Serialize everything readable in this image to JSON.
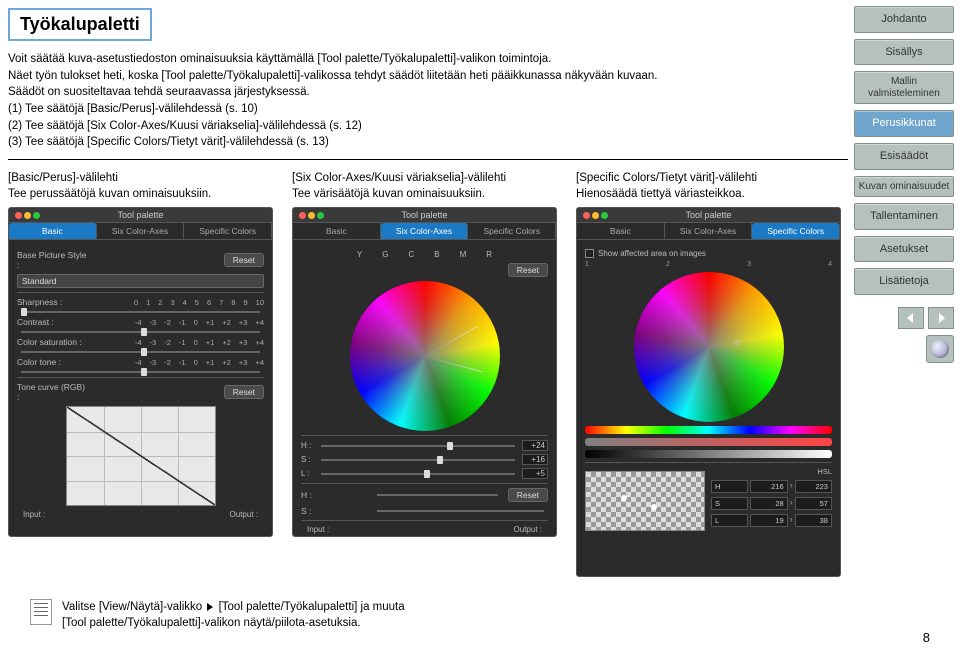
{
  "pageNumber": "8",
  "title": "Työkalupaletti",
  "intro": {
    "l1": "Voit säätää kuva-asetustiedoston ominaisuuksia käyttämällä [Tool palette/Työkalupaletti]-valikon toimintoja.",
    "l2": "Näet työn tulokset heti, koska [Tool palette/Työkalupaletti]-valikossa tehdyt säädöt liitetään heti pääikkunassa näkyvään kuvaan.",
    "l3": "Säädöt on suositeltavaa tehdä seuraavassa järjestyksessä.",
    "l4": "(1) Tee säätöjä [Basic/Perus]-välilehdessä (s. 10)",
    "l5": "(2) Tee säätöjä [Six Color-Axes/Kuusi väriakselia]-välilehdessä (s. 12)",
    "l6": "(3) Tee säätöjä [Specific Colors/Tietyt värit]-välilehdessä (s. 13)"
  },
  "cols": {
    "c1h": "[Basic/Perus]-välilehti",
    "c1s": "Tee perussäätöjä kuvan ominaisuuksiin.",
    "c2h": "[Six Color-Axes/Kuusi väriakselia]-välilehti",
    "c2s": "Tee värisäätöjä kuvan ominaisuuksiin.",
    "c3h": "[Specific Colors/Tietyt värit]-välilehti",
    "c3s": "Hienosäädä tiettyä väriasteikkoa."
  },
  "sidebar": {
    "johdanto": "Johdanto",
    "sisallys": "Sisällys",
    "mallin": "Mallin valmisteleminen",
    "perusikkunat": "Perusikkunat",
    "esisaadot": "Esisäädöt",
    "kuvan": "Kuvan ominaisuudet",
    "tallentaminen": "Tallentaminen",
    "asetukset": "Asetukset",
    "lisatietoja": "Lisätietoja"
  },
  "palette": {
    "winTitle": "Tool palette",
    "tabs": {
      "basic": "Basic",
      "six": "Six Color-Axes",
      "specific": "Specific Colors"
    },
    "basePictureStyle": "Base Picture Style :",
    "standard": "Standard",
    "reset": "Reset",
    "sharpness": "Sharpness :",
    "contrast": "Contrast :",
    "colorSaturation": "Color saturation :",
    "colorTone": "Color tone :",
    "toneCurve": "Tone curve (RGB) :",
    "input": "Input :",
    "output": "Output :",
    "scaleA": [
      "0",
      "1",
      "2",
      "3",
      "4",
      "5",
      "6",
      "7",
      "8",
      "9",
      "10"
    ],
    "scaleB": [
      "-4",
      "-3",
      "-2",
      "-1",
      "0",
      "+1",
      "+2",
      "+3",
      "+4"
    ],
    "H": "H :",
    "S": "S :",
    "L": "L :",
    "Y": "Y",
    "G": "G",
    "C": "C",
    "B": "B",
    "M": "M",
    "R": "R",
    "showAffected": "Show affected area on images",
    "hslVals": {
      "hp": "+24",
      "sp": "+16",
      "lp": "+5",
      "h": "H",
      "s": "S",
      "l": "L",
      "hn": "216",
      "sn": "28",
      "ln": "19",
      "ha": "223",
      "sa": "57",
      "la": "38"
    },
    "hslHeader": "HSL",
    "arrow": "⇕",
    "range4": [
      "1",
      "2",
      "3",
      "4"
    ]
  },
  "note": {
    "l1a": "Valitse [View/Näytä]-valikko",
    "l1b": "[Tool palette/Työkalupaletti] ja muuta",
    "l2": "[Tool palette/Työkalupaletti]-valikon näytä/piilota-asetuksia."
  }
}
